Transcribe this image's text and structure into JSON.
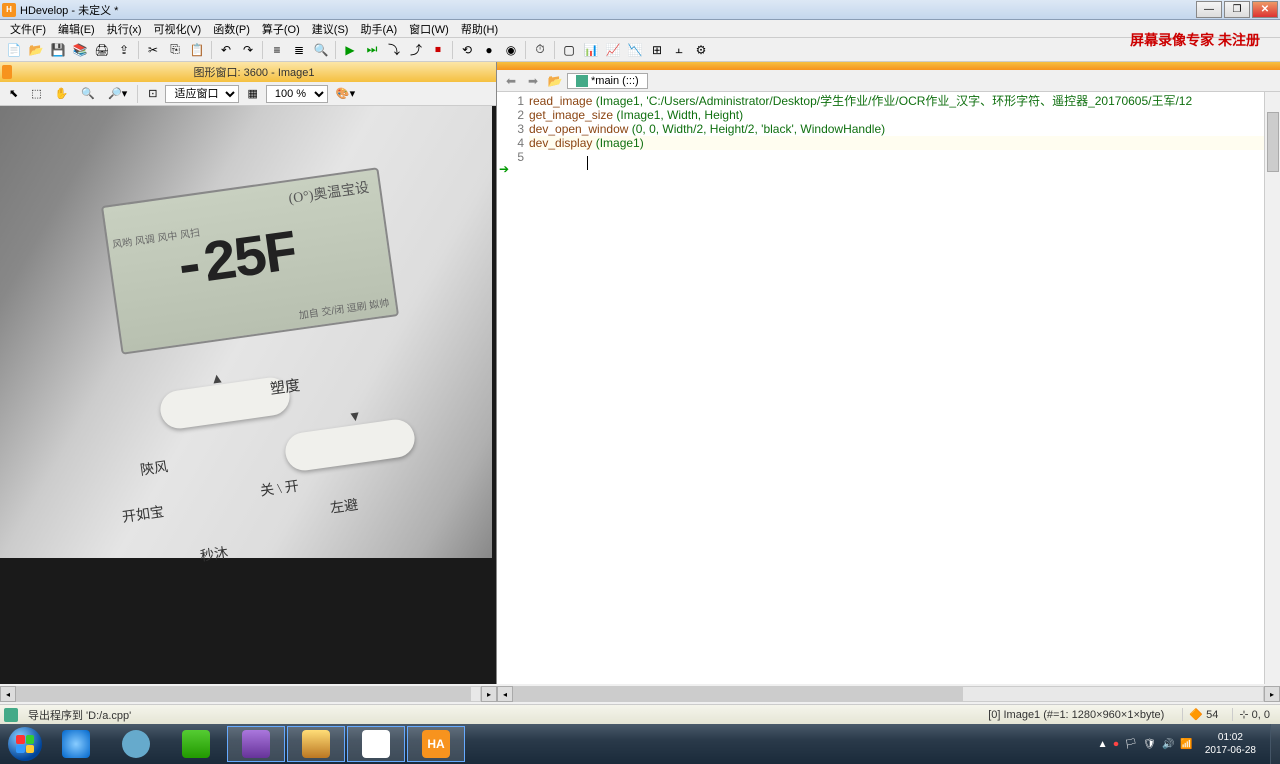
{
  "title": "HDevelop - 未定义 *",
  "menu": [
    "文件(F)",
    "编辑(E)",
    "执行(x)",
    "可视化(V)",
    "函数(P)",
    "算子(O)",
    "建议(S)",
    "助手(A)",
    "窗口(W)",
    "帮助(H)"
  ],
  "watermark": "屏幕录像专家 未注册",
  "image_window": {
    "title": "图形窗口: 3600 - Image1",
    "fit_label": "适应窗口",
    "zoom_label": "100 %",
    "lcd_top": "(O°)奥温宝设",
    "lcd_digits": "-25F",
    "lcd_left": "风哟\n风调\n风中\n风扫",
    "lcd_right": "加自\n交/闭\n逗刷\n姒帅",
    "btn_labels": {
      "center": "塑度",
      "left1": "陝风",
      "mid": "关 \\ 开",
      "right": "左避",
      "left2": "开如宝",
      "left3": "秒沐"
    }
  },
  "editor": {
    "tab_label": "*main (:::)",
    "lines": [
      {
        "n": "1",
        "op": "read_image",
        "args": " (Image1, 'C:/Users/Administrator/Desktop/学生作业/作业/OCR作业_汉字、环形字符、遥控器_20170605/王军/12"
      },
      {
        "n": "2",
        "op": "get_image_size",
        "args": " (Image1, Width, Height)"
      },
      {
        "n": "3",
        "op": "dev_open_window",
        "args": " (0, 0, Width/2, Height/2, 'black', WindowHandle)"
      },
      {
        "n": "4",
        "op": "dev_display",
        "args": " (Image1)"
      },
      {
        "n": "5",
        "op": "",
        "args": ""
      }
    ]
  },
  "status": {
    "left_text": "导出程序到 'D:/a.cpp'",
    "image_info": "[0] Image1 (#=1: 1280×960×1×byte)",
    "num1": "54",
    "coords": "0, 0"
  },
  "taskbar": {
    "ha_label": "HA",
    "clock_time": "01:02",
    "clock_date": "2017-06-28"
  }
}
